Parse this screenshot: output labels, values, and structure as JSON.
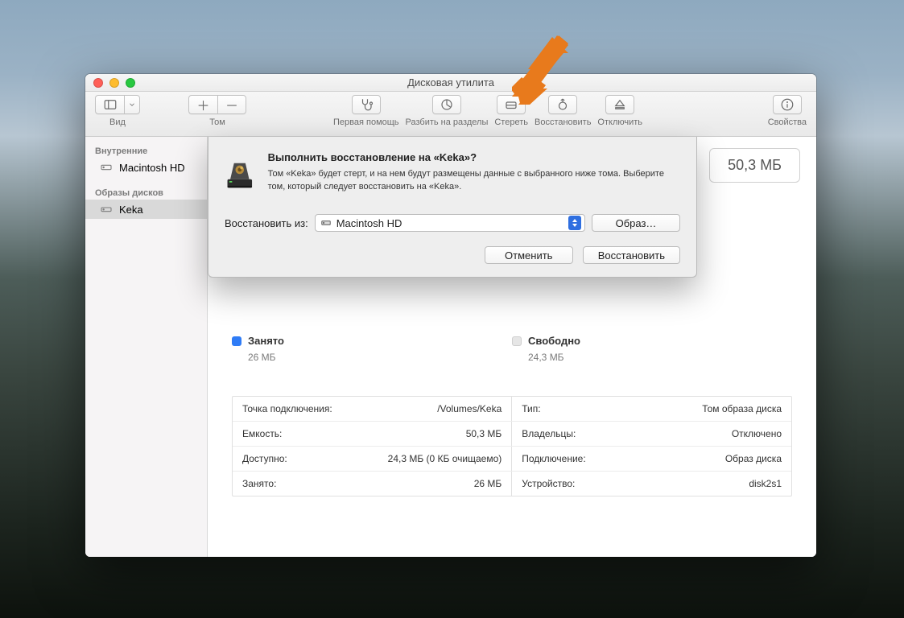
{
  "window": {
    "title": "Дисковая утилита"
  },
  "toolbar": {
    "view": "Вид",
    "volume": "Том",
    "first_aid": "Первая помощь",
    "partition": "Разбить на разделы",
    "erase": "Стереть",
    "restore": "Восстановить",
    "unmount": "Отключить",
    "info": "Свойства"
  },
  "sidebar": {
    "section_internal": "Внутренние",
    "internal": [
      {
        "label": "Macintosh HD"
      }
    ],
    "section_images": "Образы дисков",
    "images": [
      {
        "label": "Keka"
      }
    ]
  },
  "size_badge": "50,3 МБ",
  "dialog": {
    "title": "Выполнить восстановление на «Keka»?",
    "body": "Том «Keka» будет стерт, и на нем будут размещены данные с выбранного ниже тома. Выберите том, который следует восстановить на «Keka».",
    "restore_from_label": "Восстановить из:",
    "restore_from_value": "Macintosh HD",
    "image_button": "Образ…",
    "cancel": "Отменить",
    "confirm": "Восстановить"
  },
  "usage": {
    "busy_label": "Занято",
    "busy_value": "26 МБ",
    "free_label": "Свободно",
    "free_value": "24,3 МБ"
  },
  "details_left": [
    {
      "k": "Точка подключения:",
      "v": "/Volumes/Keka"
    },
    {
      "k": "Емкость:",
      "v": "50,3 МБ"
    },
    {
      "k": "Доступно:",
      "v": "24,3 МБ (0 КБ очищаемо)"
    },
    {
      "k": "Занято:",
      "v": "26 МБ"
    }
  ],
  "details_right": [
    {
      "k": "Тип:",
      "v": "Том образа диска"
    },
    {
      "k": "Владельцы:",
      "v": "Отключено"
    },
    {
      "k": "Подключение:",
      "v": "Образ диска"
    },
    {
      "k": "Устройство:",
      "v": "disk2s1"
    }
  ]
}
